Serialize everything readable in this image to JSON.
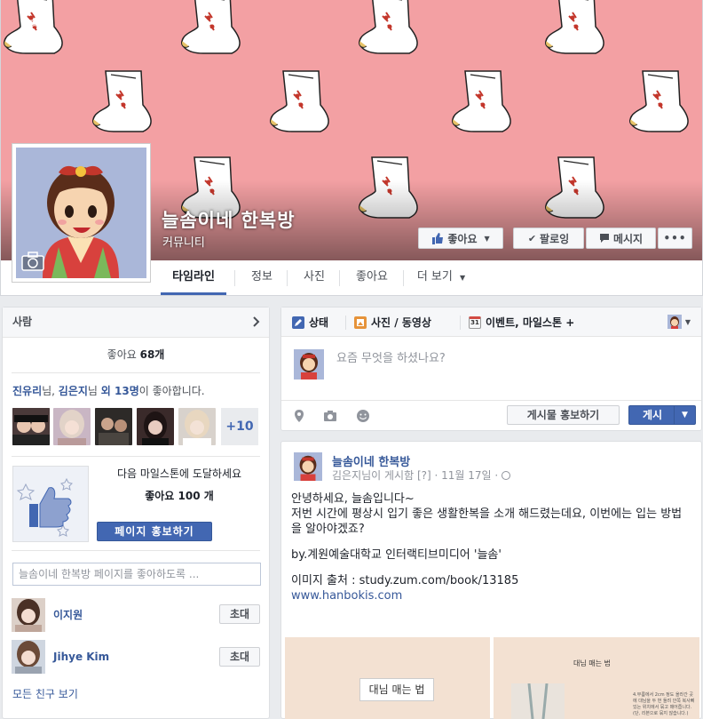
{
  "page": {
    "name": "늘솜이네 한복방",
    "category": "커뮤니티",
    "like_button": "좋아요",
    "follow_button": "팔로잉",
    "message_button": "메시지",
    "more_button": "•••"
  },
  "nav": {
    "tabs": [
      {
        "label": "타임라인",
        "active": true
      },
      {
        "label": "정보"
      },
      {
        "label": "사진"
      },
      {
        "label": "좋아요"
      },
      {
        "label": "더 보기"
      }
    ]
  },
  "people": {
    "header": "사람",
    "like_prefix": "좋아요 ",
    "like_count": "68개",
    "friends_first": "진유리",
    "friends_mid": "님, ",
    "friends_second": "김은지",
    "friends_and": "님 ",
    "friends_others": "외 13명",
    "friends_suffix": "이 좋아합니다.",
    "more_count": "+10"
  },
  "milestone": {
    "text": "다음 마일스톤에 도달하세요",
    "goal": "좋아요 100 개",
    "promote_button": "페이지 홍보하기"
  },
  "invite": {
    "placeholder": "늘솜이네 한복방 페이지를 좋아하도록 ...",
    "friends": [
      {
        "name": "이지원",
        "button": "초대"
      },
      {
        "name": "Jihye Kim",
        "button": "초대"
      }
    ],
    "all_friends": "모든 친구 보기"
  },
  "composer": {
    "tabs": [
      "상태",
      "사진 / 동영상",
      "이벤트, 마일스톤 +"
    ],
    "calendar_day": "31",
    "placeholder": "요즘 무엇을 하셨나요?",
    "boost_button": "게시물 홍보하기",
    "post_button": "게시"
  },
  "post": {
    "author": "늘솜이네 한복방",
    "posted_by": "김은지님이 게시함",
    "meta_sep": " [?] · ",
    "date": "11월 17일",
    "globe": "·",
    "line1": "안녕하세요, 늘솜입니다~",
    "line2": "저번 시간에 평상시 입기 좋은 생활한복을 소개 해드렸는데요, 이번에는 입는 방법을 알아야겠죠?",
    "line3": "by.계원예술대학교 인터랙티브미디어 '늘솜'",
    "line4": "이미지 출처 : study.zum.com/book/13185",
    "link": "www.hanbokis.com",
    "img1_label": "대님 매는 법",
    "img2_label": "대님 매는 법",
    "img2_note": "4.무릎에서 2cm 정도 올라간 곳에 대님을 두 번 돌려 안쪽 복사뼈 있는 위치에서 묶고 매어줍니다.(단, 리본으로 묶지 않습니다.)"
  },
  "colors": {
    "cover_bg": "#f3a0a3",
    "accent": "#4267b2",
    "link": "#365899"
  }
}
